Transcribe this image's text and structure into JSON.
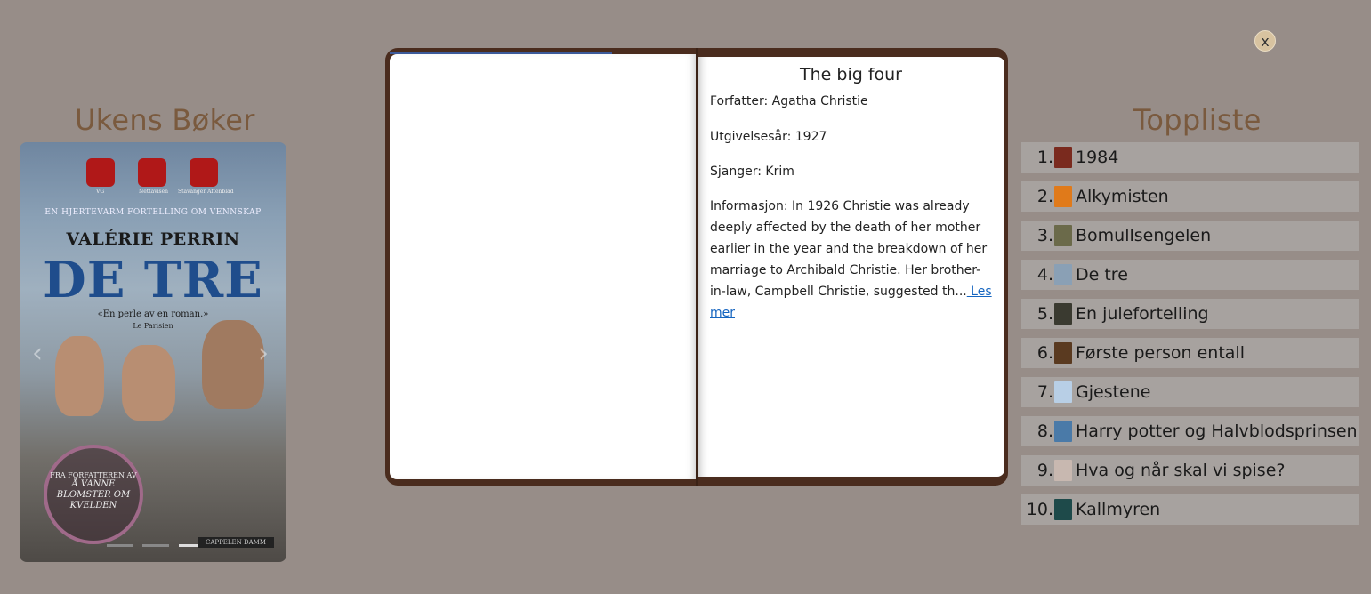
{
  "left_section": {
    "title": "Ukens Bøker",
    "cover": {
      "tagline": "EN HJERTEVARM FORTELLING OM VENNSKAP",
      "author": "VALÉRIE PERRIN",
      "title": "DE TRE",
      "quote": "«En perle av en roman.»",
      "quote_source": "Le Parisien",
      "dice_labels": [
        "VG",
        "Nettavisen",
        "Stavanger Aftenblad"
      ],
      "badge_top": "FRA FORFATTEREN AV",
      "badge_title": "Å VANNE BLOMSTER OM KVELDEN",
      "publisher": "CAPPELEN DAMM"
    },
    "prev_icon": "chevron-left-icon",
    "next_icon": "chevron-right-icon",
    "prev_glyph": "‹",
    "next_glyph": "›",
    "indicator_count": 3,
    "active_indicator": 3
  },
  "book_modal": {
    "title": "The big four",
    "author_line": "Forfatter: Agatha Christie",
    "year_line": "Utgivelsesår: 1927",
    "genre_line": "Sjanger: Krim",
    "description": "Informasjon: In 1926 Christie was already deeply affected by the death of her mother earlier in the year and the breakdown of her marriage to Archibald Christie. Her brother-in-law, Campbell Christie, suggested th...",
    "read_more": " Les mer",
    "close_label": "x"
  },
  "right_section": {
    "title": "Toppliste",
    "items": [
      {
        "rank": "1.",
        "title": "1984",
        "thumb_color": "#7a2a1e"
      },
      {
        "rank": "2.",
        "title": "Alkymisten",
        "thumb_color": "#e07a1a"
      },
      {
        "rank": "3.",
        "title": "Bomullsengelen",
        "thumb_color": "#6b6a4a"
      },
      {
        "rank": "4.",
        "title": "De tre",
        "thumb_color": "#8aa0b5"
      },
      {
        "rank": "5.",
        "title": "En julefortelling",
        "thumb_color": "#3a3a30"
      },
      {
        "rank": "6.",
        "title": "Første person entall",
        "thumb_color": "#5a3a20"
      },
      {
        "rank": "7.",
        "title": "Gjestene",
        "thumb_color": "#b8cfe6"
      },
      {
        "rank": "8.",
        "title": "Harry potter og Halvblodsprinsen",
        "thumb_color": "#4a7aa8"
      },
      {
        "rank": "9.",
        "title": "Hva og når skal vi spise?",
        "thumb_color": "#c8b8b0"
      },
      {
        "rank": "10.",
        "title": "Kallmyren",
        "thumb_color": "#1e4a4a"
      }
    ]
  },
  "colors": {
    "background": "#978d88",
    "heading": "#7a5a3e",
    "book_frame": "#4a2c1e",
    "list_item_bg": "#a7a29f",
    "link": "#1565c0"
  }
}
